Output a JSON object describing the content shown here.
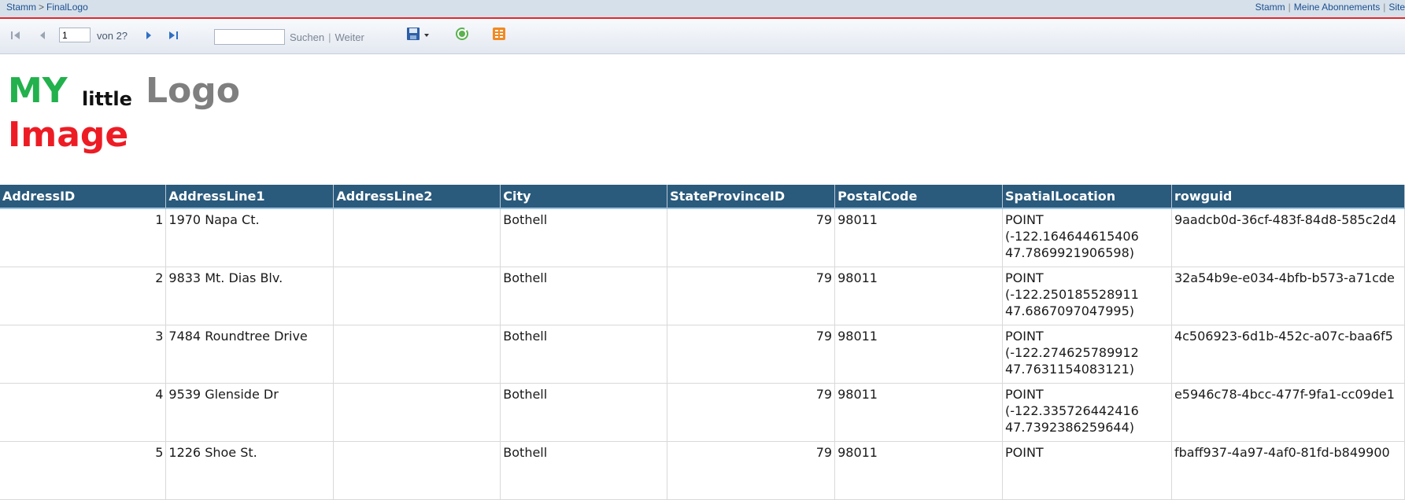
{
  "breadcrumb": {
    "home": "Stamm",
    "separator": ">",
    "current": "FinalLogo"
  },
  "toplinks": {
    "home": "Stamm",
    "subscriptions": "Meine Abonnements",
    "site": "Site"
  },
  "toolbar": {
    "page_value": "1",
    "page_count": "von 2?",
    "search_placeholder": "",
    "search_label": "Suchen",
    "next_label": "Weiter"
  },
  "logo": {
    "my": "MY",
    "little": "little",
    "logo": "Logo",
    "image": "Image"
  },
  "colors": {
    "header_bg": "#2a5a7c",
    "accent_red": "#e0282c",
    "logo_green": "#22b14c",
    "logo_gray": "#7f7f7f",
    "logo_red": "#ed1c24"
  },
  "table": {
    "columns": [
      "AddressID",
      "AddressLine1",
      "AddressLine2",
      "City",
      "StateProvinceID",
      "PostalCode",
      "SpatialLocation",
      "rowguid"
    ],
    "rows": [
      {
        "AddressID": "1",
        "AddressLine1": "1970 Napa Ct.",
        "AddressLine2": "",
        "City": "Bothell",
        "StateProvinceID": "79",
        "PostalCode": "98011",
        "SpatialLocation": "POINT\n(-122.164644615406\n47.7869921906598)",
        "rowguid": "9aadcb0d-36cf-483f-84d8-585c2d4"
      },
      {
        "AddressID": "2",
        "AddressLine1": "9833 Mt. Dias Blv.",
        "AddressLine2": "",
        "City": "Bothell",
        "StateProvinceID": "79",
        "PostalCode": "98011",
        "SpatialLocation": "POINT\n(-122.250185528911\n47.6867097047995)",
        "rowguid": "32a54b9e-e034-4bfb-b573-a71cde"
      },
      {
        "AddressID": "3",
        "AddressLine1": "7484 Roundtree Drive",
        "AddressLine2": "",
        "City": "Bothell",
        "StateProvinceID": "79",
        "PostalCode": "98011",
        "SpatialLocation": "POINT\n(-122.274625789912\n47.7631154083121)",
        "rowguid": "4c506923-6d1b-452c-a07c-baa6f5"
      },
      {
        "AddressID": "4",
        "AddressLine1": "9539 Glenside Dr",
        "AddressLine2": "",
        "City": "Bothell",
        "StateProvinceID": "79",
        "PostalCode": "98011",
        "SpatialLocation": "POINT\n(-122.335726442416\n47.7392386259644)",
        "rowguid": "e5946c78-4bcc-477f-9fa1-cc09de1"
      },
      {
        "AddressID": "5",
        "AddressLine1": "1226 Shoe St.",
        "AddressLine2": "",
        "City": "Bothell",
        "StateProvinceID": "79",
        "PostalCode": "98011",
        "SpatialLocation": "POINT",
        "rowguid": "fbaff937-4a97-4af0-81fd-b849900"
      }
    ]
  }
}
